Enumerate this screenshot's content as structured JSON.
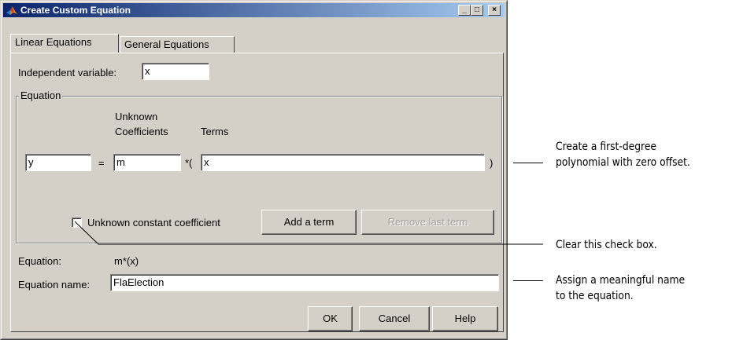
{
  "window": {
    "title": "Create Custom Equation",
    "minimize_glyph": "_",
    "maximize_glyph": "□",
    "close_glyph": "×"
  },
  "tabs": [
    {
      "label": "Linear Equations",
      "active": true
    },
    {
      "label": "General Equations",
      "active": false
    }
  ],
  "independent_variable": {
    "label": "Independent variable:",
    "value": "x"
  },
  "equation_group": {
    "title": "Equation",
    "unknown_coefficients_header_line1": "Unknown",
    "unknown_coefficients_header_line2": "Coefficients",
    "terms_header": "Terms",
    "lhs_value": "y",
    "equals": "=",
    "coefficient_value": "m",
    "times_open": "*(",
    "term_value": "x",
    "close_paren": ")",
    "unknown_constant_label": "Unknown constant coefficient",
    "unknown_constant_checked": false,
    "add_term_label": "Add a term",
    "remove_term_label": "Remove last term"
  },
  "equation_preview": {
    "label": "Equation:",
    "value": "m*(x)"
  },
  "equation_name": {
    "label": "Equation name:",
    "value": "FlaElection"
  },
  "buttons": {
    "ok": "OK",
    "cancel": "Cancel",
    "help": "Help"
  },
  "annotations": [
    {
      "line1": "Create a first-degree",
      "line2": "polynomial with zero offset."
    },
    {
      "line1": "Clear this check box."
    },
    {
      "line1": "Assign a meaningful name",
      "line2": "to the equation."
    }
  ],
  "colors": {
    "titlebar_start": "#0a246a",
    "titlebar_end": "#a6caf0",
    "face": "#d4d0c8"
  }
}
